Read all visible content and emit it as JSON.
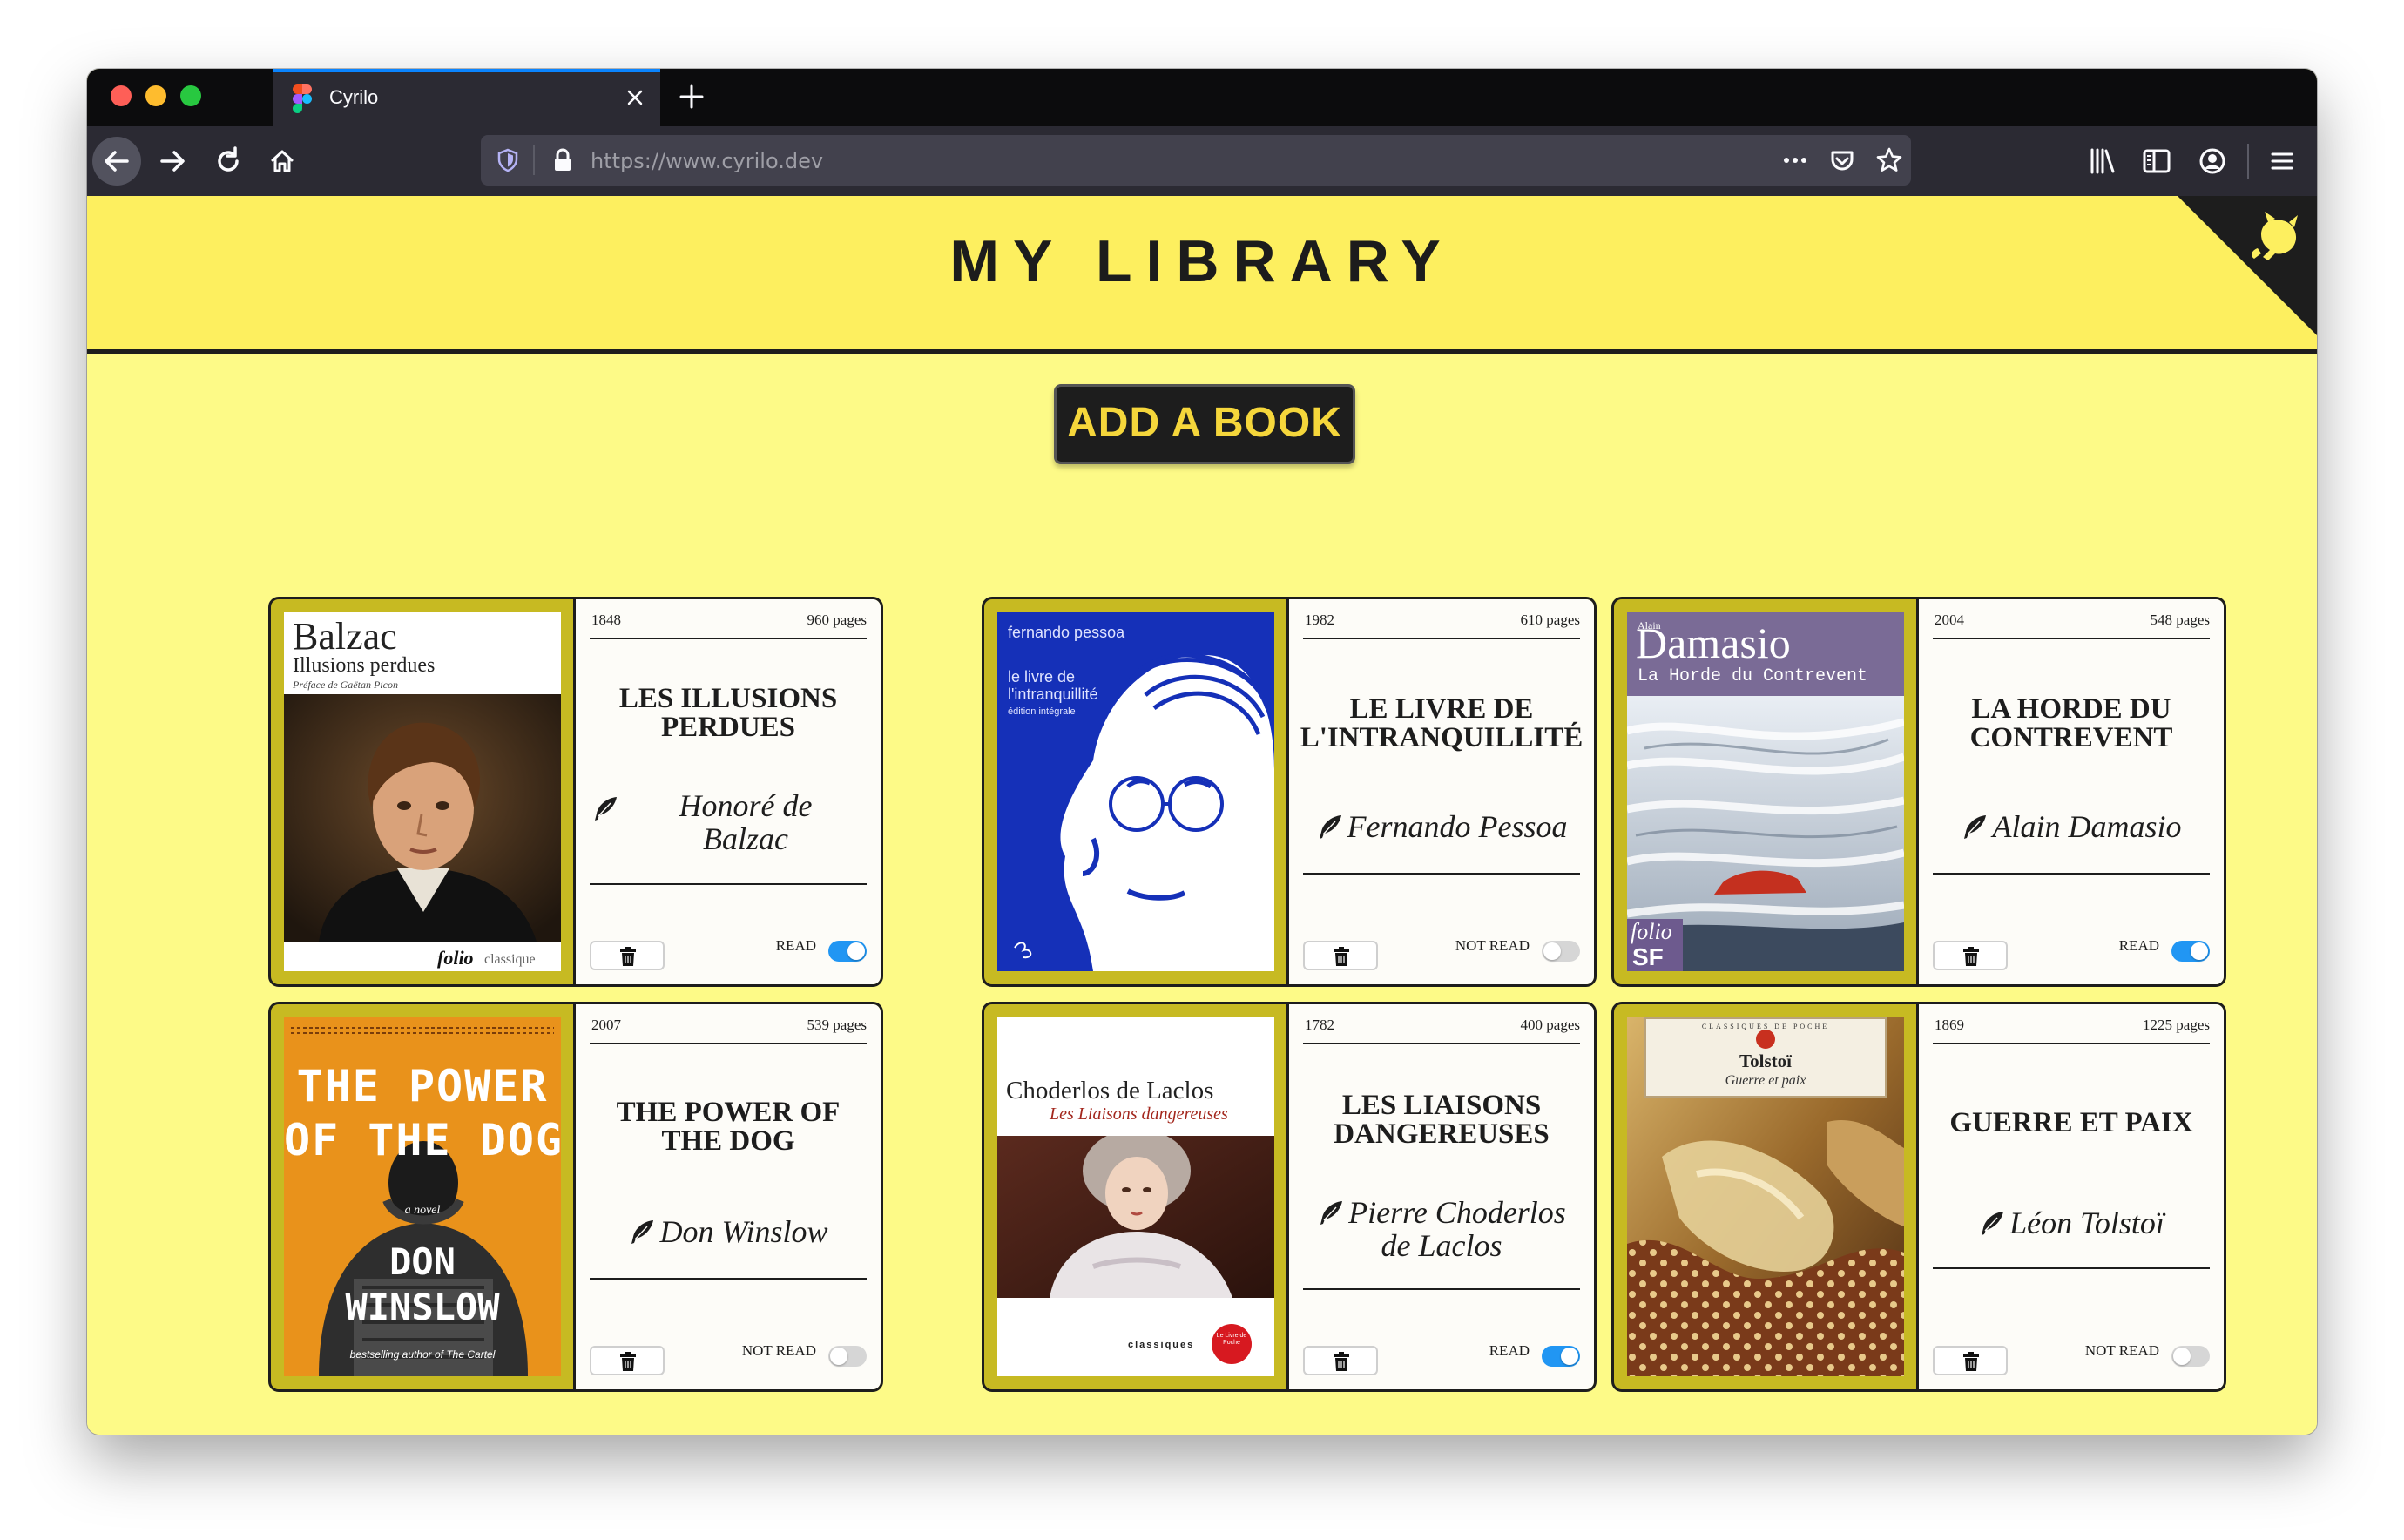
{
  "browser": {
    "tab_title": "Cyrilo",
    "url": "https://www.cyrilo.dev"
  },
  "page": {
    "title": "MY LIBRARY",
    "add_button": "ADD A BOOK"
  },
  "colors": {
    "header_bg": "#fdef5f",
    "page_bg": "#fdfa87",
    "card_frame": "#c7ba22",
    "toggle_on": "#2196f3",
    "button_text": "#f5d63b"
  },
  "books": [
    {
      "year": "1848",
      "pages": "960 pages",
      "title": "LES ILLUSIONS PERDUES",
      "author_line1": "Honoré de",
      "author_line2": "Balzac",
      "status": "READ",
      "read": true,
      "cover": {
        "author": "Balzac",
        "title": "Illusions perdues",
        "subtitle": "Préface de Gaëtan Picon",
        "publisher": "folio",
        "collection": "classique"
      }
    },
    {
      "year": "1982",
      "pages": "610 pages",
      "title": "LE LIVRE DE L'INTRANQUILLITÉ",
      "author_line1": "Fernando Pessoa",
      "author_line2": "",
      "status": "NOT READ",
      "read": false,
      "cover": {
        "author": "fernando pessoa",
        "title_line1": "le livre de",
        "title_line2": "l'intranquillité",
        "subtitle": "édition intégrale"
      }
    },
    {
      "year": "2004",
      "pages": "548 pages",
      "title": "LA HORDE DU CONTREVENT",
      "author_line1": "Alain Damasio",
      "author_line2": "",
      "status": "READ",
      "read": true,
      "cover": {
        "firstname": "Alain",
        "author": "Damasio",
        "title": "La Horde du Contrevent",
        "publisher": "folio",
        "collection": "SF"
      }
    },
    {
      "year": "2007",
      "pages": "539 pages",
      "title": "THE POWER OF THE DOG",
      "author_line1": "Don Winslow",
      "author_line2": "",
      "status": "NOT READ",
      "read": false,
      "cover": {
        "title_line1": "THE POWER",
        "title_line2": "OF THE DOG",
        "tag": "a novel",
        "author_line1": "DON",
        "author_line2": "WINSLOW",
        "blurb": "bestselling author of The Cartel"
      }
    },
    {
      "year": "1782",
      "pages": "400 pages",
      "title": "LES LIAISONS DANGEREUSES",
      "author_line1": "Pierre Choderlos",
      "author_line2": "de Laclos",
      "status": "READ",
      "read": true,
      "cover": {
        "author": "Choderlos de Laclos",
        "title": "Les Liaisons dangereuses",
        "collection": "classiques",
        "publisher": "Le Livre de Poche"
      }
    },
    {
      "year": "1869",
      "pages": "1225 pages",
      "title": "GUERRE ET PAIX",
      "author_line1": "Léon Tolstoï",
      "author_line2": "",
      "status": "NOT READ",
      "read": false,
      "cover": {
        "series": "CLASSIQUES DE POCHE",
        "author": "Tolstoï",
        "title": "Guerre et paix"
      }
    }
  ]
}
